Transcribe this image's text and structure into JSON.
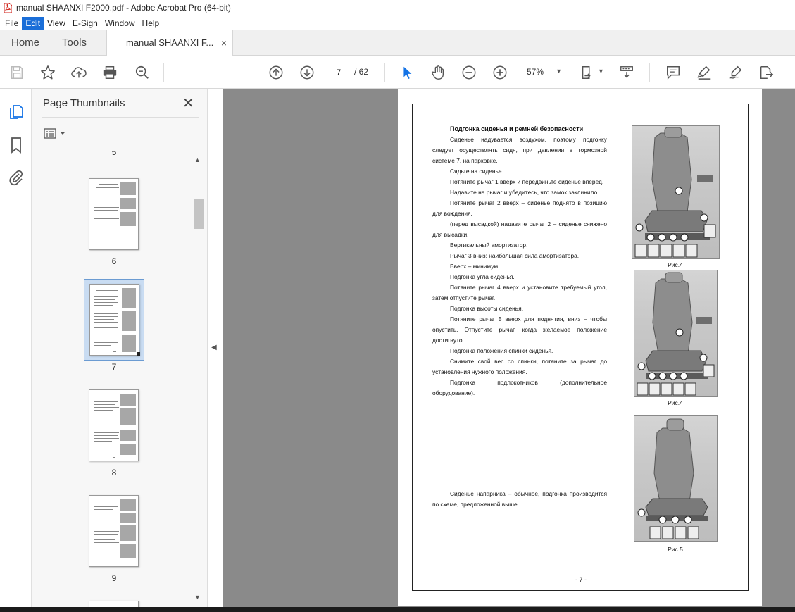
{
  "window": {
    "title": "manual SHAANXI F2000.pdf - Adobe Acrobat Pro (64-bit)"
  },
  "menu": [
    "File",
    "Edit",
    "View",
    "E-Sign",
    "Window",
    "Help"
  ],
  "tabs": {
    "home": "Home",
    "tools": "Tools",
    "document": "manual SHAANXI F...",
    "close": "×"
  },
  "toolbar": {
    "current_page": "7",
    "total_pages": "/ 62",
    "zoom": "57%",
    "icons": [
      "save-icon",
      "star-icon",
      "upload-icon",
      "print-icon",
      "zoom-search-icon",
      "prev-page-icon",
      "next-page-icon",
      "select-cursor-icon",
      "hand-icon",
      "zoom-out-icon",
      "zoom-in-icon",
      "fit-page-icon",
      "scroll-mode-icon",
      "comment-icon",
      "highlight-icon",
      "sign-icon",
      "export-icon"
    ]
  },
  "thumbnails_panel": {
    "title": "Page Thumbnails",
    "close": "✕",
    "partial_label": "5",
    "pages": [
      "6",
      "7",
      "8",
      "9"
    ],
    "selected_page": "7"
  },
  "document": {
    "heading": "Подгонка сиденья и ремней безопасности",
    "paragraphs": [
      "Сиденье надувается воздухом, поэтому подгонку следует осуществлять сидя, при давлении в тормозной системе 7, на парковке.",
      "Сядьте на сиденье.",
      "Потяните рычаг 1 вверх и передвиньте сиденье вперед.",
      "Надавите на рычаг и убедитесь, что замок заклинило.",
      "Потяните рычаг 2 вверх – сиденье поднято в позицию для вождения.",
      "(перед высадкой) надавите рычаг 2 – сиденье снижено для высадки.",
      "Вертикальный амортизатор.",
      "Рычаг 3 вниз: наибольшая сила амортизатора.",
      "Вверх – минимум.",
      "Подгонка угла сиденья.",
      "Потяните рычаг 4 вверх и установите требуемый угол, затем отпустите рычаг.",
      "Подгонка высоты сиденья.",
      "Потяните рычаг 5 вверх для поднятия, вниз – чтобы опустить. Отпустите рычаг, когда желаемое положение достигнуто.",
      "Подгонка положения спинки сиденья.",
      "Снимите свой вес со спинки, потяните за рычаг до установления нужного положения.",
      "Подгонка подлокотников (дополнительное оборудование)."
    ],
    "footer_paragraph": "Сиденье напарника – обычное, подгонка производится по схеме, предложенной выше.",
    "captions": [
      "Рис.4",
      "Рис.4",
      "Рис.5"
    ],
    "page_number": "- 7 -"
  }
}
